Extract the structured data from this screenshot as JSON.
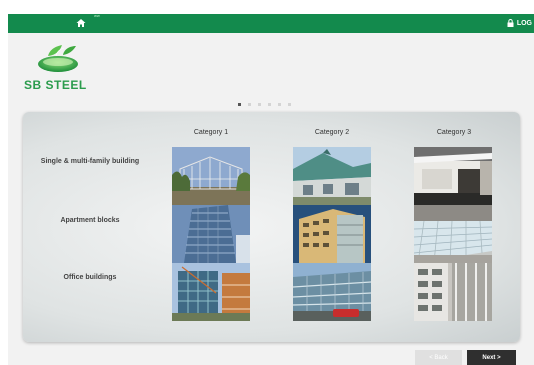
{
  "topbar": {
    "logout_label": "LOG",
    "tiny_label": "ww",
    "color": "#138a4d"
  },
  "logo": {
    "text": "SB STEEL",
    "color": "#2b9c4d"
  },
  "pagination": {
    "count": 6,
    "active_index": 0
  },
  "grid": {
    "columns": [
      "Category 1",
      "Category 2",
      "Category 3"
    ],
    "rows": [
      {
        "label": "Single & multi-family building",
        "images": [
          "steel-frame-house-photo",
          "green-roof-house-photo",
          "modern-white-house-photo"
        ]
      },
      {
        "label": "Apartment blocks",
        "images": [
          "glass-apartment-tower-photo",
          "beige-apartment-block-photo",
          "glass-atrium-roof-photo"
        ]
      },
      {
        "label": "Office buildings",
        "images": [
          "office-steel-frame-photo",
          "glass-office-building-photo",
          "white-facade-office-photo"
        ]
      }
    ]
  },
  "nav": {
    "back_label": "< Back",
    "next_label": "Next >"
  },
  "icons": {
    "home": "home-icon",
    "lock": "lock-icon"
  }
}
